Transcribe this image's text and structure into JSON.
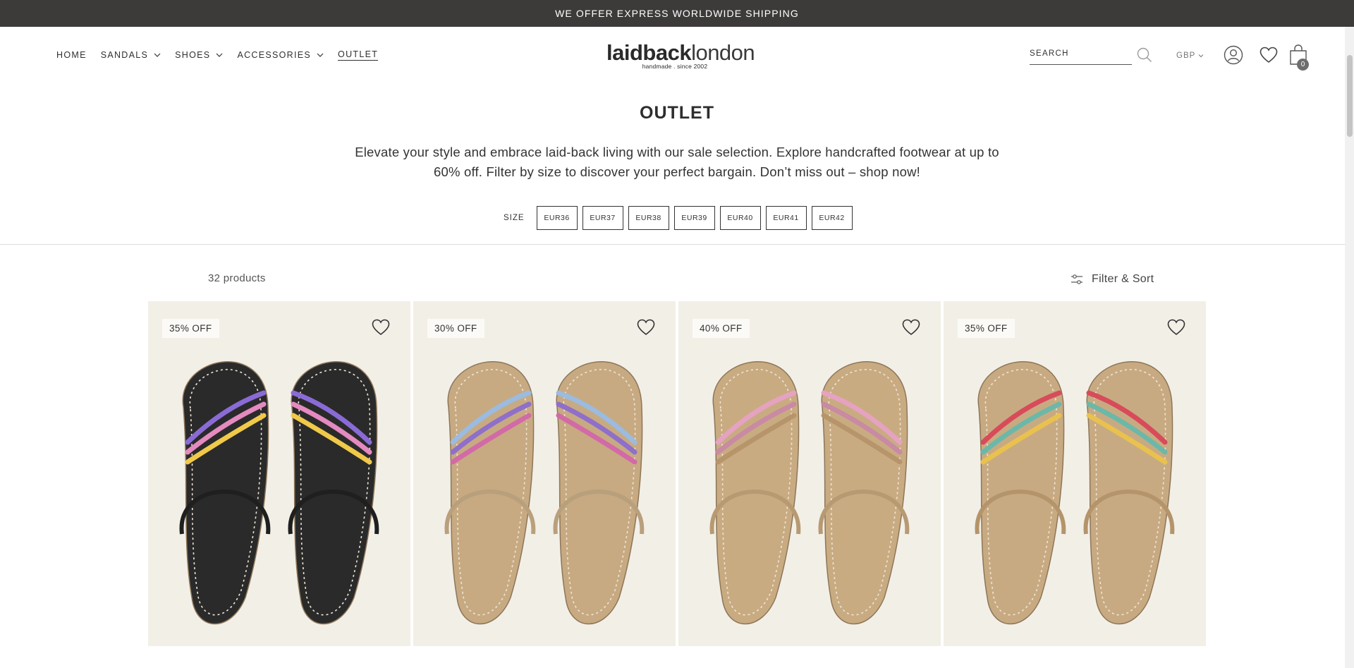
{
  "announcement": "WE OFFER EXPRESS WORLDWIDE SHIPPING",
  "nav": {
    "home": "HOME",
    "sandals": "SANDALS",
    "shoes": "SHOES",
    "accessories": "ACCESSORIES",
    "outlet": "OUTLET"
  },
  "logo": {
    "bold": "laidback",
    "light": "london",
    "tagline": "handmade . since 2002"
  },
  "search": {
    "placeholder": "SEARCH"
  },
  "currency": "GBP",
  "cart": {
    "count": "0"
  },
  "page": {
    "title": "OUTLET",
    "description": "Elevate your style and embrace laid-back living with our sale selection. Explore handcrafted footwear at up to 60% off. Filter by size to discover your perfect bargain. Don’t miss out – shop now!"
  },
  "size_filter": {
    "label": "SIZE",
    "options": [
      "EUR36",
      "EUR37",
      "EUR38",
      "EUR39",
      "EUR40",
      "EUR41",
      "EUR42"
    ]
  },
  "results": {
    "count": "32 products",
    "filter_sort": "Filter & Sort"
  },
  "products": [
    {
      "badge": "35% OFF",
      "strap_color": "#1f1f1f",
      "sole_color": "#2a2a2a",
      "bead_colors": [
        "#8a6bd6",
        "#e48ac0",
        "#f0c94a"
      ]
    },
    {
      "badge": "30% OFF",
      "strap_color": "#b9a07c",
      "sole_color": "#c7aa82",
      "bead_colors": [
        "#9bbbe0",
        "#8f6fc9",
        "#d36aa8"
      ]
    },
    {
      "badge": "40% OFF",
      "strap_color": "#b79a72",
      "sole_color": "#c9ab82",
      "bead_colors": [
        "#e6a2c1",
        "#c98aa3",
        "#b7956b"
      ]
    },
    {
      "badge": "35% OFF",
      "strap_color": "#b4946b",
      "sole_color": "#c8aa82",
      "bead_colors": [
        "#d84b5a",
        "#6cb8a8",
        "#e9c14f"
      ]
    }
  ]
}
